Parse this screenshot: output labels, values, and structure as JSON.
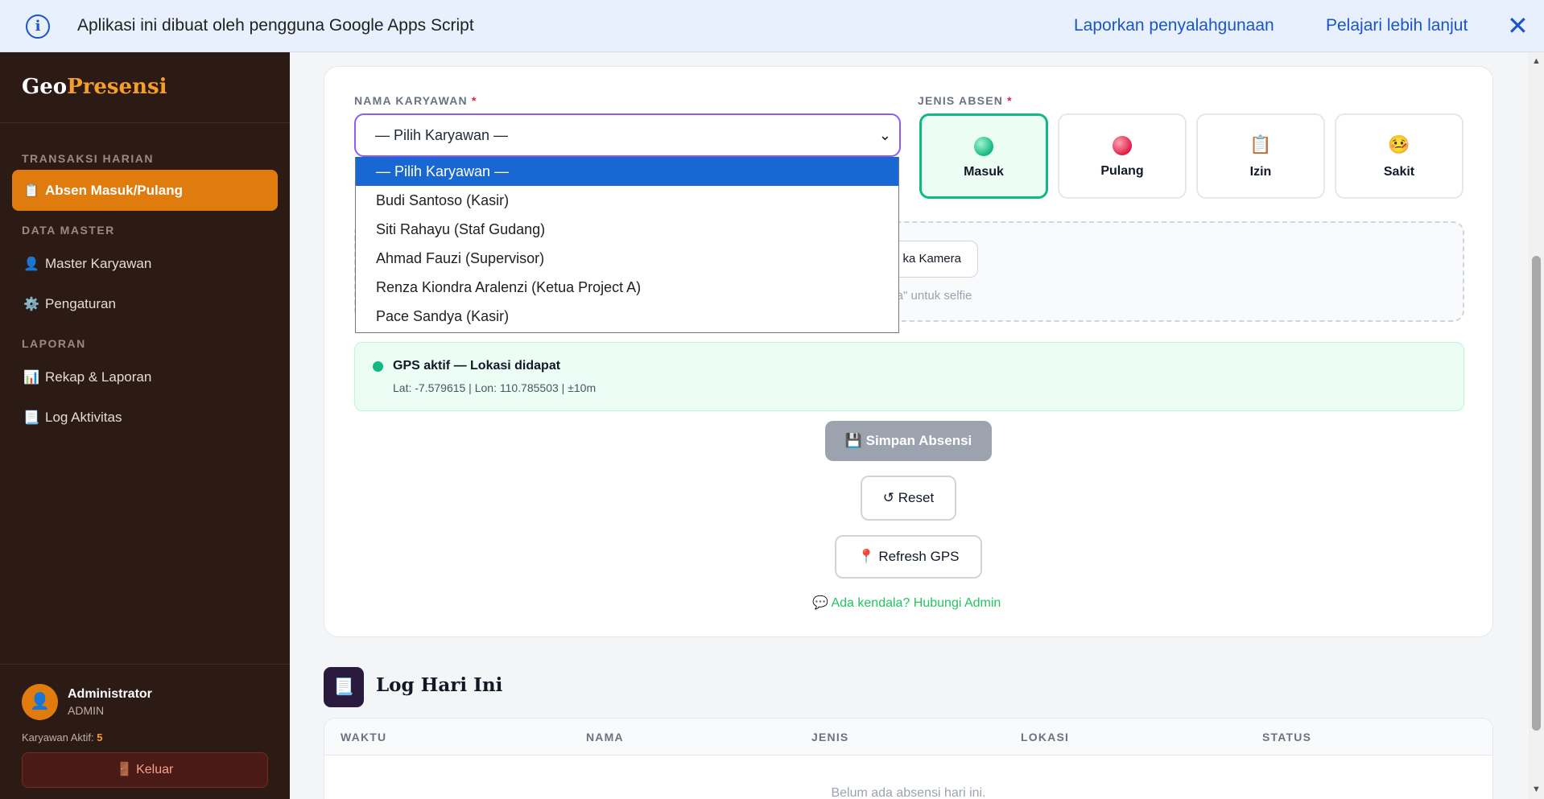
{
  "banner": {
    "message": "Aplikasi ini dibuat oleh pengguna Google Apps Script",
    "report_link": "Laporkan penyalahgunaan",
    "learn_link": "Pelajari lebih lanjut",
    "close_icon": "✕",
    "info_icon": "i"
  },
  "sidebar": {
    "brand_geo": "Geo",
    "brand_presensi": "Presensi",
    "sections": {
      "transaksi": "TRANSAKSI HARIAN",
      "master": "DATA MASTER",
      "laporan": "LAPORAN"
    },
    "items": [
      {
        "icon": "📋",
        "label": "Absen Masuk/Pulang",
        "active": true
      },
      {
        "icon": "👤",
        "label": "Master Karyawan"
      },
      {
        "icon": "⚙️",
        "label": "Pengaturan"
      },
      {
        "icon": "📊",
        "label": "Rekap & Laporan"
      },
      {
        "icon": "📃",
        "label": "Log Aktivitas"
      }
    ],
    "user": {
      "avatar_icon": "👤",
      "name": "Administrator",
      "role": "ADMIN",
      "active_label": "Karyawan Aktif: ",
      "active_count": "5",
      "logout_icon": "🚪",
      "logout_label": "Keluar"
    }
  },
  "form": {
    "employee_label": "NAMA KARYAWAN",
    "type_label": "JENIS ABSEN",
    "required_mark": "*",
    "selected_employee": "— Pilih Karyawan —",
    "dropdown_options": [
      "— Pilih Karyawan —",
      "Budi Santoso (Kasir)",
      "Siti Rahayu (Staf Gudang)",
      "Ahmad Fauzi (Supervisor)",
      "Renza Kiondra Aralenzi (Ketua Project A)",
      "Pace Sandya (Kasir)"
    ],
    "types": [
      {
        "label": "Masuk",
        "icon": "green-dot",
        "color": "#34d399",
        "selected": true
      },
      {
        "label": "Pulang",
        "icon": "red-dot",
        "color": "#e11d48"
      },
      {
        "label": "Izin",
        "icon": "📋"
      },
      {
        "label": "Sakit",
        "icon": "🤒"
      }
    ],
    "camera_button": "ka Kamera",
    "camera_hint": "nera\" untuk selfie",
    "gps_title": "GPS aktif — Lokasi didapat",
    "gps_coords": "Lat: -7.579615 | Lon: 110.785503 | ±10m",
    "save_button": "💾 Simpan Absensi",
    "reset_button": "↺ Reset",
    "refresh_gps_button": "📍 Refresh GPS",
    "help_link": "💬 Ada kendala? Hubungi Admin"
  },
  "log": {
    "icon": "📃",
    "title": "Log Hari Ini",
    "columns": [
      "WAKTU",
      "NAMA",
      "JENIS",
      "LOKASI",
      "STATUS"
    ],
    "empty_text": "Belum ada absensi hari ini."
  },
  "colors": {
    "sidebar_bg": "#2c1a14",
    "accent": "#e07b0e",
    "selected_type_border": "#10b981",
    "banner_link": "#1a56c8"
  }
}
